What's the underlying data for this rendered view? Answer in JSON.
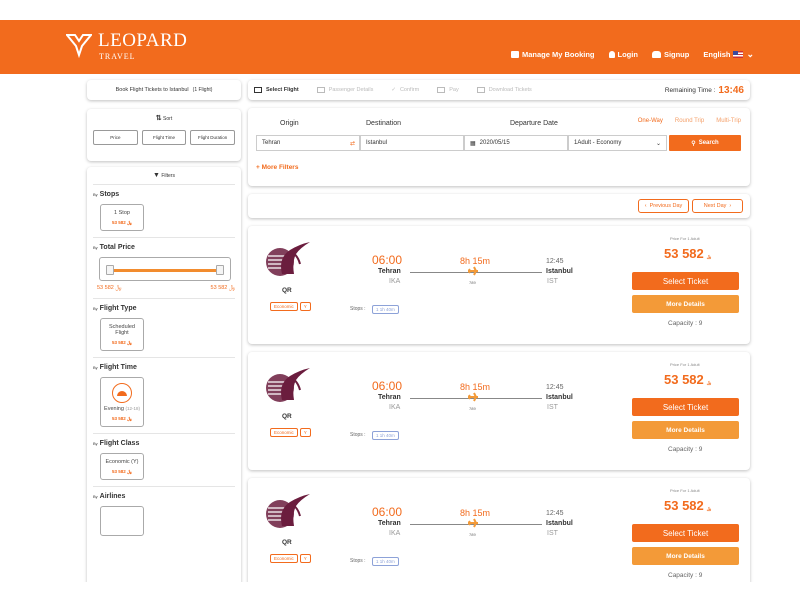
{
  "header": {
    "logo_title": "LEOPARD",
    "logo_sub": "TRAVEL",
    "nav": [
      "Manage My Booking",
      "Login",
      "Signup",
      "English"
    ],
    "colors": {
      "brand": "#f26b1d",
      "secondary": "#f39a38",
      "stops": "#8da2d8"
    }
  },
  "sidebar": {
    "book_title": "Book Flight Tickets to Istanbul",
    "book_count": "(1 Flight)",
    "sort_label": "Sort",
    "sort_options": [
      "Price",
      "Flight Time",
      "Flight Duration"
    ],
    "filters_label": "Filters",
    "by": "By",
    "sections": {
      "stops": {
        "title": "Stops",
        "option": "1 Stop",
        "price": "53 582 ﷼"
      },
      "total_price": {
        "title": "Total Price",
        "min": "﷼ 582 53",
        "max": "﷼ 582 53"
      },
      "flight_type": {
        "title": "Flight Type",
        "option": "Scheduled Flight",
        "price": "53 582 ﷼"
      },
      "flight_time": {
        "title": "Flight Time",
        "option": "Evening",
        "range": "(12-18)",
        "price": "53 582 ﷼"
      },
      "flight_class": {
        "title": "Flight Class",
        "option": "Economic (Y)",
        "price": "53 582 ﷼"
      },
      "airlines": {
        "title": "Airlines"
      }
    }
  },
  "steps": {
    "items": [
      "Select Flight",
      "Passenger Details",
      "Confirm",
      "Pay",
      "Download Tickets"
    ],
    "remaining_label": "Remaining Time :",
    "remaining_time": "13:46"
  },
  "search": {
    "origin_label": "Origin",
    "destination_label": "Destination",
    "date_label": "Departure Date",
    "trip_types": [
      "One-Way",
      "Round Trip",
      "Multi-Trip"
    ],
    "origin": "Tehran",
    "destination": "Istanbul",
    "date": "2020/05/15",
    "passengers": "1Adult - Economy",
    "search_btn": "Search",
    "more_filters": "More Filters"
  },
  "day_nav": {
    "prev": "Previous Day",
    "next": "Next Day"
  },
  "flights": [
    {
      "airline": "QR",
      "cabin": "Economic",
      "cabin_code": "Y",
      "dep_time": "06:00",
      "dep_city": "Tehran",
      "dep_code": "IKA",
      "duration": "8h 15m",
      "flight_no": "789",
      "arr_time": "12:45",
      "arr_city": "Istanbul",
      "arr_code": "IST",
      "stops_label": "Stops :",
      "stops": "1 1h 40m",
      "price_for": "Price For 1 Adult",
      "price": "53 582",
      "currency": "﷼",
      "select": "Select Ticket",
      "details": "More Details",
      "capacity": "Capacity : 9"
    },
    {
      "airline": "QR",
      "cabin": "Economic",
      "cabin_code": "Y",
      "dep_time": "06:00",
      "dep_city": "Tehran",
      "dep_code": "IKA",
      "duration": "8h 15m",
      "flight_no": "789",
      "arr_time": "12:45",
      "arr_city": "Istanbul",
      "arr_code": "IST",
      "stops_label": "Stops :",
      "stops": "1 1h 40m",
      "price_for": "Price For 1 Adult",
      "price": "53 582",
      "currency": "﷼",
      "select": "Select Ticket",
      "details": "More Details",
      "capacity": "Capacity : 9"
    },
    {
      "airline": "QR",
      "cabin": "Economic",
      "cabin_code": "Y",
      "dep_time": "06:00",
      "dep_city": "Tehran",
      "dep_code": "IKA",
      "duration": "8h 15m",
      "flight_no": "789",
      "arr_time": "12:45",
      "arr_city": "Istanbul",
      "arr_code": "IST",
      "stops_label": "Stops :",
      "stops": "1 1h 40m",
      "price_for": "Price For 1 Adult",
      "price": "53 582",
      "currency": "﷼",
      "select": "Select Ticket",
      "details": "More Details",
      "capacity": "Capacity : 9"
    }
  ]
}
